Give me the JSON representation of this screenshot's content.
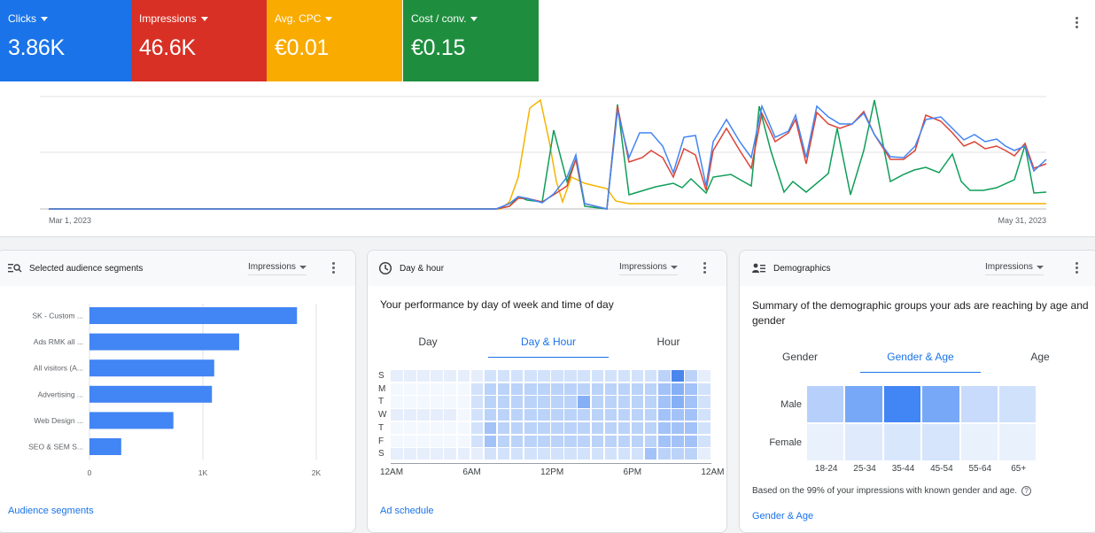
{
  "metrics": [
    {
      "label": "Clicks",
      "value": "3.86K",
      "color": "#1a73e8"
    },
    {
      "label": "Impressions",
      "value": "46.6K",
      "color": "#d93025"
    },
    {
      "label": "Avg. CPC",
      "value": "€0.01",
      "color": "#f9ab00"
    },
    {
      "label": "Cost / conv.",
      "value": "€0.15",
      "color": "#1e8e3e"
    }
  ],
  "trend": {
    "start_label": "Mar 1, 2023",
    "end_label": "May 31, 2023",
    "series_colors": {
      "clicks": "#4285f4",
      "impressions": "#db4437",
      "cpc": "#f4b400",
      "cost": "#0f9d58"
    }
  },
  "audience": {
    "title": "Selected audience segments",
    "metric_label": "Impressions",
    "link": "Audience segments",
    "bars": [
      {
        "label": "SK - Custom ...",
        "value": 1830
      },
      {
        "label": "Ads RMK all ...",
        "value": 1320
      },
      {
        "label": "All visitors (A...",
        "value": 1100
      },
      {
        "label": "Advertising ...",
        "value": 1080
      },
      {
        "label": "Web Design ...",
        "value": 740
      },
      {
        "label": "SEO & SEM S...",
        "value": 280
      }
    ],
    "axis_ticks": [
      "0",
      "1K",
      "2K"
    ],
    "axis_max": 2000
  },
  "dayhour": {
    "title": "Day & hour",
    "metric_label": "Impressions",
    "subtitle": "Your performance by day of week and time of day",
    "tabs": [
      "Day",
      "Day & Hour",
      "Hour"
    ],
    "active_tab": 1,
    "days": [
      "S",
      "M",
      "T",
      "W",
      "T",
      "F",
      "S"
    ],
    "hour_ticks": [
      "12AM",
      "6AM",
      "12PM",
      "6PM",
      "12AM"
    ],
    "link": "Ad schedule"
  },
  "demographics": {
    "title": "Demographics",
    "metric_label": "Impressions",
    "subtitle": "Summary of the demographic groups your ads are reaching by age and gender",
    "tabs": [
      "Gender",
      "Gender & Age",
      "Age"
    ],
    "active_tab": 1,
    "rows": [
      "Male",
      "Female"
    ],
    "cols": [
      "18-24",
      "25-34",
      "35-44",
      "45-54",
      "55-64",
      "65+"
    ],
    "levels": [
      [
        0.35,
        0.7,
        1.0,
        0.7,
        0.25,
        0.2
      ],
      [
        0.06,
        0.12,
        0.15,
        0.17,
        0.06,
        0.06
      ]
    ],
    "note": "Based on the 99% of your impressions with known gender and age.",
    "link": "Gender & Age"
  }
}
